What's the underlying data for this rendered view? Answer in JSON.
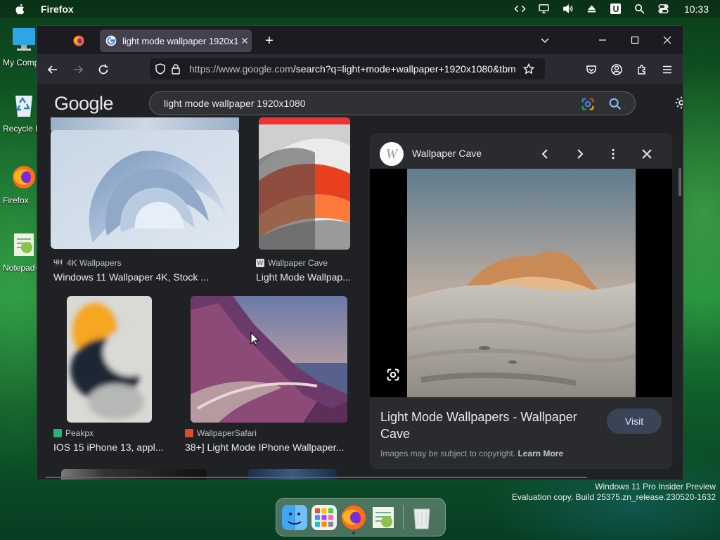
{
  "menubar": {
    "app_name": "Firefox",
    "clock": "10:33",
    "icons": [
      "code-arrows-icon",
      "display-icon",
      "volume-icon",
      "eject-icon",
      "u-icon",
      "search-icon",
      "control-center-icon"
    ],
    "u_label": "U"
  },
  "desktop_icons": [
    {
      "label": "My Computer",
      "icon": "computer-icon"
    },
    {
      "label": "Recycle Bin",
      "icon": "recycle-bin-icon"
    },
    {
      "label": "Firefox",
      "icon": "firefox-icon"
    },
    {
      "label": "Notepad++",
      "icon": "notepad-icon"
    }
  ],
  "watermark": {
    "line1": "Windows 11 Pro Insider Preview",
    "line2": "Evaluation copy. Build 25375.zn_release.230520-1632"
  },
  "browser": {
    "active_tab_title": "light mode wallpaper 1920x1080",
    "url_host": "https://www.google.com",
    "url_path": "/search?q=light+mode+wallpaper+1920x1080&tbm"
  },
  "google": {
    "logo": "Google",
    "query": "light mode wallpaper 1920x1080"
  },
  "results": [
    {
      "source": "4K Wallpapers",
      "source_icon": "4k",
      "caption": "Windows 11 Wallpaper 4K, Stock ..."
    },
    {
      "source": "Wallpaper Cave",
      "source_icon": "W",
      "caption": "Light Mode Wallpap..."
    },
    {
      "source": "Peakpx",
      "caption": "IOS 15 iPhone 13, appl..."
    },
    {
      "source": "WallpaperSafari",
      "caption": "38+] Light Mode IPhone Wallpaper..."
    }
  ],
  "preview": {
    "site_name": "Wallpaper Cave",
    "site_logo_letter": "W",
    "title": "Light Mode Wallpapers - Wallpaper Cave",
    "visit_label": "Visit",
    "copyright_text": "Images may be subject to copyright.",
    "learn_more": "Learn More"
  },
  "colors": {
    "page_bg": "#202124",
    "panel_bg": "#2a2b2e",
    "visit_bg": "#394457",
    "tabbar_bg": "#1c1b22",
    "navbar_bg": "#2b2a33"
  }
}
